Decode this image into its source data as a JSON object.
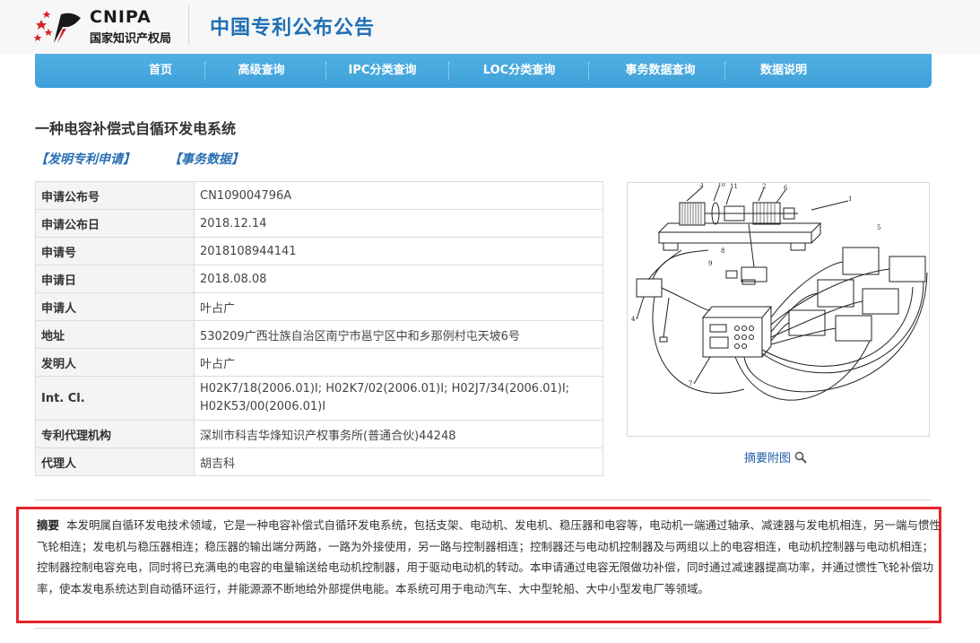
{
  "header": {
    "logo_en": "CNIPA",
    "logo_cn": "国家知识产权局",
    "site_title": "中国专利公布公告"
  },
  "nav": {
    "items": [
      "首页",
      "高级查询",
      "IPC分类查询",
      "LOC分类查询",
      "事务数据查询",
      "数据说明"
    ]
  },
  "patent": {
    "title": "一种电容补偿式自循环发电系统",
    "links": [
      "【发明专利申请】",
      "【事务数据】"
    ],
    "fields": [
      {
        "label": "申请公布号",
        "value": "CN109004796A"
      },
      {
        "label": "申请公布日",
        "value": "2018.12.14"
      },
      {
        "label": "申请号",
        "value": "2018108944141"
      },
      {
        "label": "申请日",
        "value": "2018.08.08"
      },
      {
        "label": "申请人",
        "value": "叶占广"
      },
      {
        "label": "地址",
        "value": "530209广西壮族自治区南宁市邕宁区中和乡那例村屯天坡6号"
      },
      {
        "label": "发明人",
        "value": "叶占广"
      },
      {
        "label": "Int. Cl.",
        "value": "H02K7/18(2006.01)I;  H02K7/02(2006.01)I;  H02J7/34(2006.01)I;",
        "value2": "H02K53/00(2006.01)I"
      },
      {
        "label": "专利代理机构",
        "value": "深圳市科吉华烽知识产权事务所(普通合伙)44248"
      },
      {
        "label": "代理人",
        "value": "胡吉科"
      }
    ],
    "figure_caption": "摘要附图",
    "abstract_label": "摘要",
    "abstract_text": "本发明属自循环发电技术领域，它是一种电容补偿式自循环发电系统，包括支架、电动机、发电机、稳压器和电容等，电动机一端通过轴承、减速器与发电机相连，另一端与惯性飞轮相连；发电机与稳压器相连；稳压器的输出端分两路，一路为外接使用，另一路与控制器相连；控制器还与电动机控制器及与两组以上的电容相连，电动机控制器与电动机相连；控制器控制电容充电，同时将已充满电的电容的电量输送给电动机控制器，用于驱动电动机的转动。本申请通过电容无限做功补偿，同时通过减速器提高功率，并通过惯性飞轮补偿功率，使本发电系统达到自动循环运行，并能源源不断地给外部提供电能。本系统可用于电动汽车、大中型轮船、大中小型发电厂等领域。"
  },
  "figure_labels": [
    "3",
    "10",
    "11",
    "2",
    "6",
    "1",
    "5",
    "8",
    "9",
    "4",
    "7"
  ],
  "colors": {
    "nav": "#42a4da",
    "title_blue": "#1f6fb5",
    "link_blue": "#2a6fb3",
    "highlight_red": "#e5262c"
  }
}
